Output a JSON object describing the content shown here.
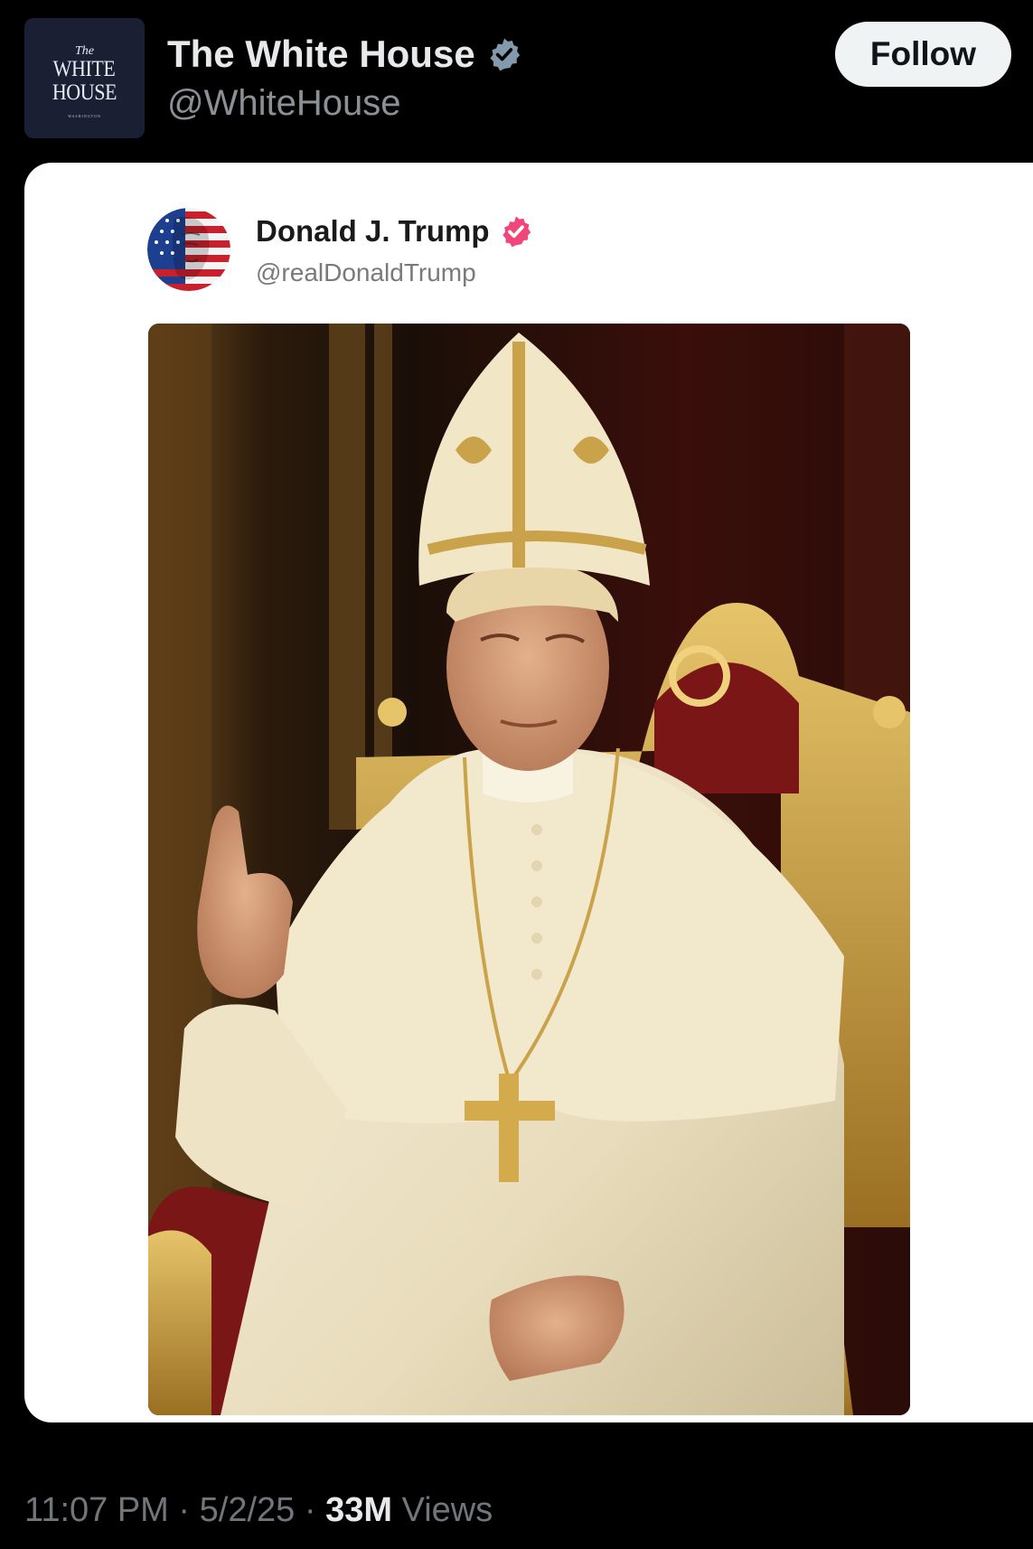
{
  "account": {
    "avatar_logo_lines": [
      "The",
      "WHITE",
      "HOUSE",
      "WASHINGTON"
    ],
    "display_name": "The White House",
    "handle": "@WhiteHouse",
    "verified_badge": "verified-gray-badge-icon",
    "verified_color": "#829aab"
  },
  "follow_button": {
    "label": "Follow"
  },
  "quoted_post": {
    "display_name": "Donald J. Trump",
    "handle": "@realDonaldTrump",
    "verified_badge": "verified-pink-badge-icon",
    "verified_color": "#f0467a",
    "image_subject": "painting-of-pope-on-golden-throne"
  },
  "meta": {
    "time": "11:07 PM",
    "separator": "·",
    "date": "5/2/25",
    "views_count": "33M",
    "views_label": "Views"
  }
}
